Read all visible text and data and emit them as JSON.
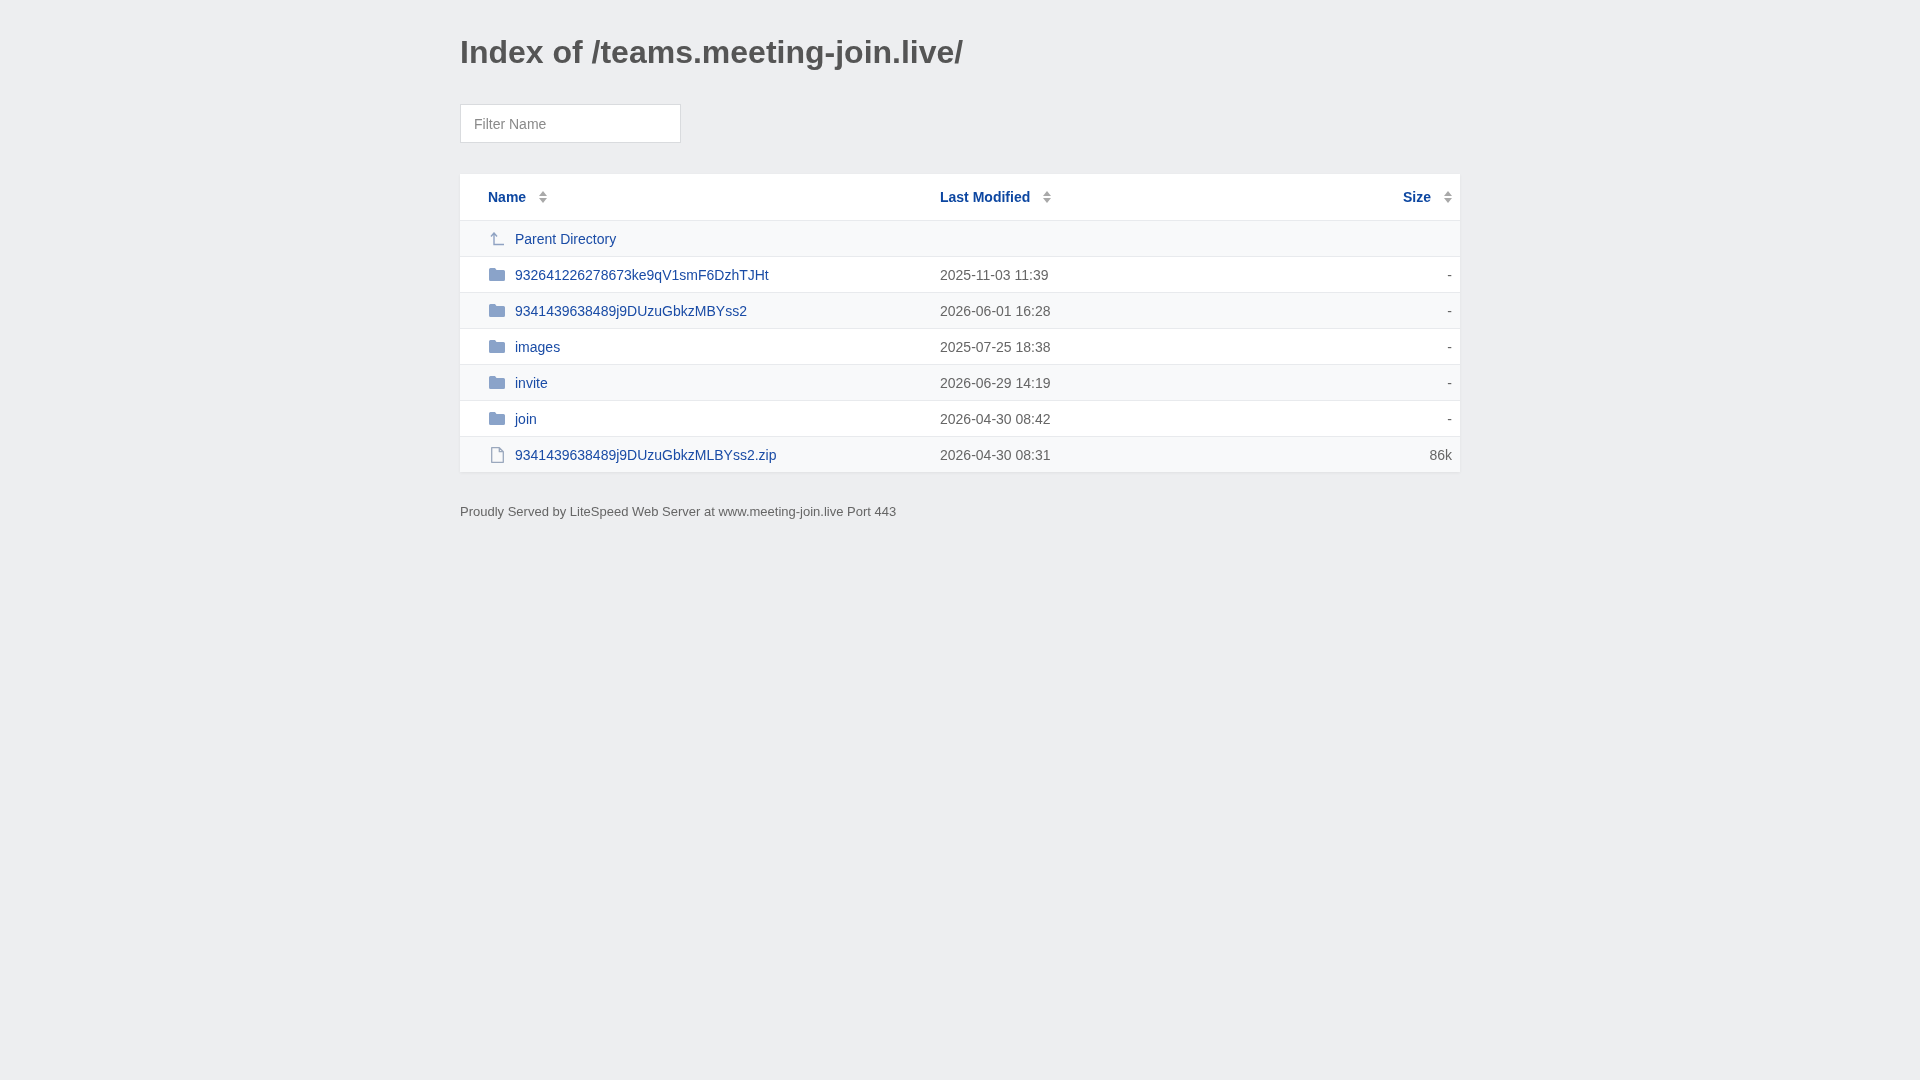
{
  "title": "Index of /teams.meeting-join.live/",
  "filter": {
    "placeholder": "Filter Name"
  },
  "table": {
    "columns": [
      {
        "label": "Name"
      },
      {
        "label": "Last Modified"
      },
      {
        "label": "Size"
      }
    ],
    "rows": [
      {
        "kind": "parent",
        "name": "Parent Directory"
      },
      {
        "kind": "folder",
        "name": "932641226278673ke9qV1smF6DzhTJHt",
        "modified": "2025-11-03 11:39",
        "size": "-"
      },
      {
        "kind": "folder",
        "name": "9341439638489j9DUzuGbkzMBYss2",
        "modified": "2026-06-01 16:28",
        "size": "-"
      },
      {
        "kind": "folder",
        "name": "images",
        "modified": "2025-07-25 18:38",
        "size": "-"
      },
      {
        "kind": "folder",
        "name": "invite",
        "modified": "2026-06-29 14:19",
        "size": "-"
      },
      {
        "kind": "folder",
        "name": "join",
        "modified": "2026-04-30 08:42",
        "size": "-"
      },
      {
        "kind": "file",
        "name": "9341439638489j9DUzuGbkzMLBYss2.zip",
        "modified": "2026-04-30 08:31",
        "size": "86k"
      }
    ]
  },
  "footer": "Proudly Served by LiteSpeed Web Server at www.meeting-join.live Port 443"
}
